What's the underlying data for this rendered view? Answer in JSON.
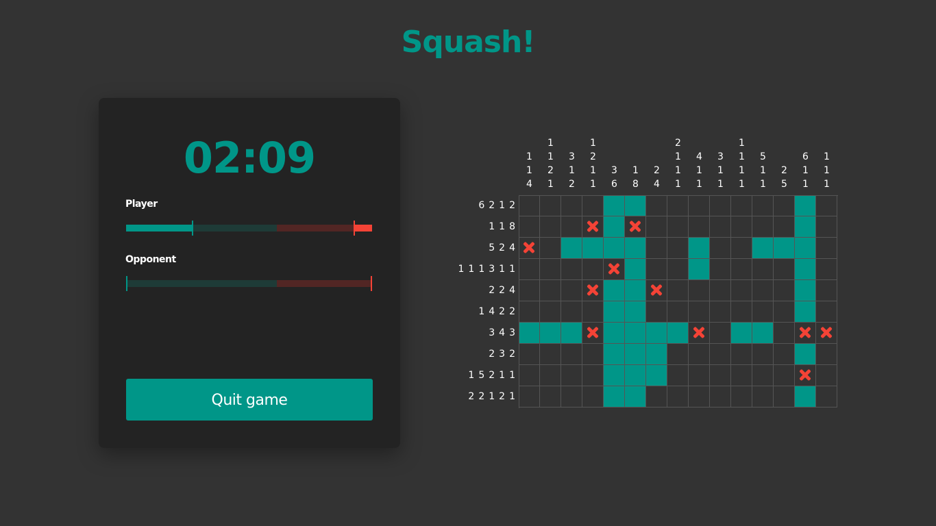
{
  "title": "Squash!",
  "timer": "02:09",
  "player": {
    "label": "Player",
    "green_progress": 0.272,
    "red_progress": 0.075
  },
  "opponent": {
    "label": "Opponent",
    "green_progress": 0.0,
    "red_progress": 0.0
  },
  "quit_label": "Quit game",
  "colors": {
    "accent": "#009688",
    "danger": "#f44336",
    "background": "#333333",
    "panel": "#232323"
  },
  "column_clues": [
    [
      "1",
      "1",
      "4"
    ],
    [
      "1",
      "1",
      "2",
      "1"
    ],
    [
      "3",
      "1",
      "2"
    ],
    [
      "1",
      "2",
      "1",
      "1"
    ],
    [
      "3",
      "6"
    ],
    [
      "1",
      "8"
    ],
    [
      "2",
      "4"
    ],
    [
      "2",
      "1",
      "1",
      "1"
    ],
    [
      "4",
      "1",
      "1"
    ],
    [
      "3",
      "1",
      "1"
    ],
    [
      "1",
      "1",
      "1",
      "1"
    ],
    [
      "5",
      "1",
      "1"
    ],
    [
      "2",
      "5"
    ],
    [
      "6",
      "1",
      "1"
    ],
    [
      "1",
      "1",
      "1"
    ]
  ],
  "row_clues": [
    [
      "6",
      "2",
      "1",
      "2"
    ],
    [
      "1",
      "1",
      "8"
    ],
    [
      "5",
      "2",
      "4"
    ],
    [
      "1",
      "1",
      "1",
      "3",
      "1",
      "1"
    ],
    [
      "2",
      "2",
      "4"
    ],
    [
      "1",
      "4",
      "2",
      "2"
    ],
    [
      "3",
      "4",
      "3"
    ],
    [
      "2",
      "3",
      "2"
    ],
    [
      "1",
      "5",
      "2",
      "1",
      "1"
    ],
    [
      "2",
      "2",
      "1",
      "2",
      "1"
    ]
  ],
  "grid": [
    "....##.......#.",
    "...x#x.......#.",
    "x.####..#..###.",
    "....x#..#....#.",
    "...x##x......#.",
    "....##.......#.",
    "###x####x.##.xx",
    "....###......#.",
    "....###......x.",
    "....##.......#."
  ]
}
